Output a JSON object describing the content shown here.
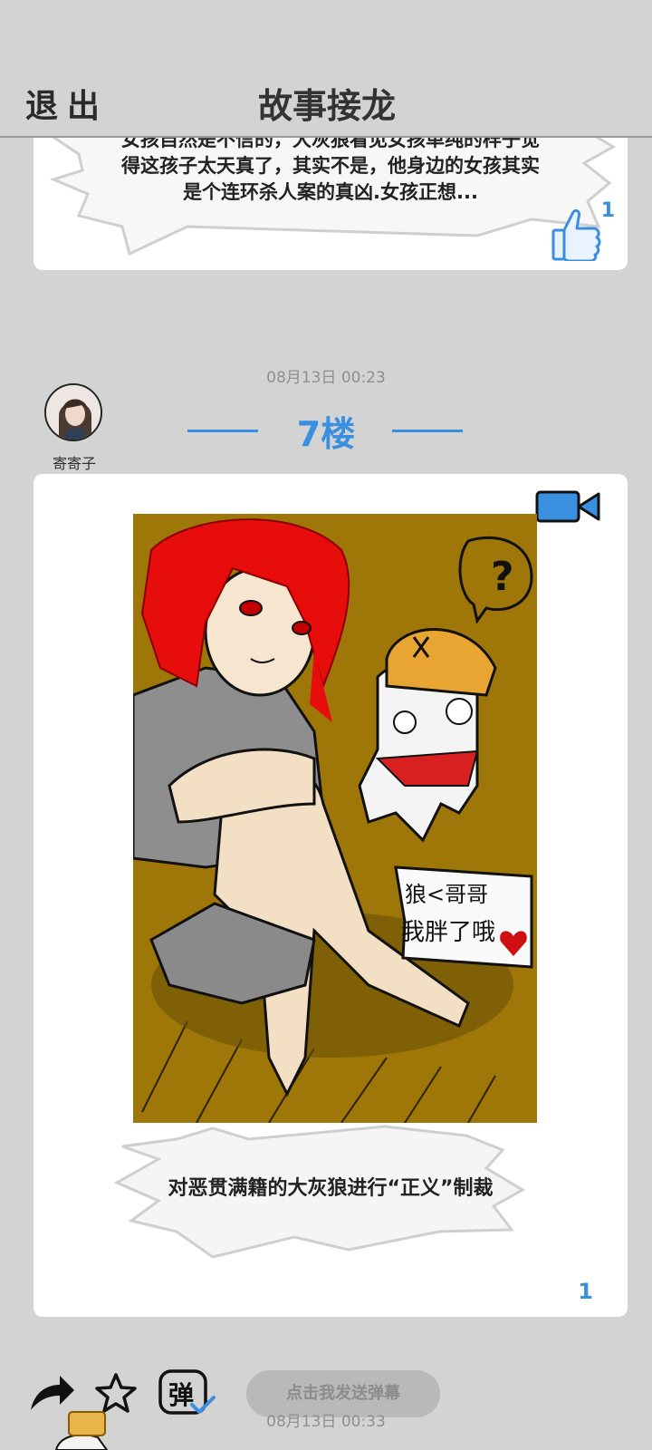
{
  "header": {
    "exit_label": "退出",
    "title": "故事接龙"
  },
  "previous_post": {
    "text": "女孩自然是不信的，大灰狼看见女孩单纯的样子觉得这孩子太天真了，其实不是，他身边的女孩其实是个连环杀人案的真凶.女孩正想...",
    "like_count": "1"
  },
  "post": {
    "date": "08月13日  00:23",
    "author": "寄寄子",
    "floor": "7楼",
    "artwork": {
      "sign_line1": "狼<哥哥",
      "sign_line2": "我胖了哦",
      "question": "?"
    },
    "caption": "对恶贯满籍的大灰狼进行“正义”制裁",
    "count": "1"
  },
  "toolbar": {
    "share_icon": "share-arrow-icon",
    "star_icon": "star-icon",
    "danmaku_icon_text": "弹",
    "danmaku_placeholder": "点击我发送弹幕"
  },
  "next_post": {
    "date": "08月13日  00:33"
  },
  "colors": {
    "accent": "#3a8fe0",
    "background": "#d3d3d3",
    "card": "#ffffff"
  }
}
